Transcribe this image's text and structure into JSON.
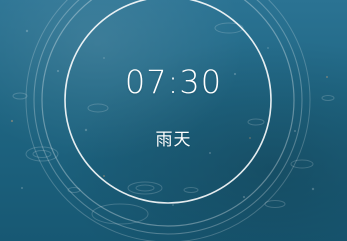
{
  "clock": {
    "time": "07:30",
    "weather_label": "雨天"
  },
  "theme": {
    "text_color": "#ffffff",
    "ring_color": "#ffffff",
    "background_top": "#2b7393",
    "background_bottom": "#175873"
  }
}
